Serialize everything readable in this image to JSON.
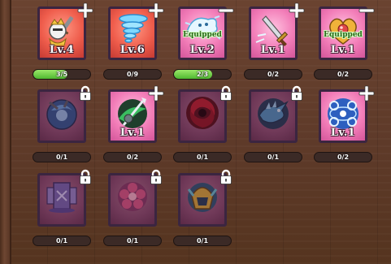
{
  "colors": {
    "progress_fill": "#4fb830",
    "card_red": "#ef5d4c",
    "card_pink": "#f27db8",
    "card_purple": "#8e4e72"
  },
  "skills": [
    {
      "icon": "knight-icon",
      "frame": "red",
      "level": "Lv.4",
      "equipped": "",
      "badge": "plus",
      "locked": false,
      "progress_text": "3/5",
      "progress": 0.6
    },
    {
      "icon": "tornado-icon",
      "frame": "red",
      "level": "Lv.6",
      "equipped": "",
      "badge": "plus",
      "locked": false,
      "progress_text": "0/9",
      "progress": 0
    },
    {
      "icon": "ice-spirit-icon",
      "frame": "pink",
      "level": "Lv.2",
      "equipped": "Equipped",
      "badge": "minus",
      "locked": false,
      "progress_text": "2/3",
      "progress": 0.667
    },
    {
      "icon": "sword-icon",
      "frame": "pink",
      "level": "Lv.1",
      "equipped": "",
      "badge": "plus",
      "locked": false,
      "progress_text": "0/2",
      "progress": 0
    },
    {
      "icon": "gold-heart-icon",
      "frame": "pink",
      "level": "Lv.1",
      "equipped": "Equipped",
      "badge": "minus",
      "locked": false,
      "progress_text": "0/2",
      "progress": 0
    },
    {
      "icon": "blue-swirl-creature-icon",
      "frame": "purple",
      "level": "",
      "equipped": "",
      "badge": "lock",
      "locked": true,
      "progress_text": "0/1",
      "progress": 0
    },
    {
      "icon": "green-spear-icon",
      "frame": "pink",
      "level": "Lv.1",
      "equipped": "",
      "badge": "plus",
      "locked": false,
      "progress_text": "0/2",
      "progress": 0
    },
    {
      "icon": "red-vortex-icon",
      "frame": "purple",
      "level": "",
      "equipped": "",
      "badge": "lock",
      "locked": true,
      "progress_text": "0/1",
      "progress": 0
    },
    {
      "icon": "ice-dragon-icon",
      "frame": "purple",
      "level": "",
      "equipped": "",
      "badge": "lock",
      "locked": true,
      "progress_text": "0/1",
      "progress": 0
    },
    {
      "icon": "orbit-rings-icon",
      "frame": "pink",
      "level": "Lv.1",
      "equipped": "",
      "badge": "plus",
      "locked": false,
      "progress_text": "0/2",
      "progress": 0
    },
    {
      "icon": "totem-shield-icon",
      "frame": "purple",
      "level": "",
      "equipped": "",
      "badge": "lock",
      "locked": true,
      "progress_text": "0/1",
      "progress": 0
    },
    {
      "icon": "flower-burst-icon",
      "frame": "purple",
      "level": "",
      "equipped": "",
      "badge": "lock",
      "locked": true,
      "progress_text": "0/1",
      "progress": 0
    },
    {
      "icon": "golden-helmet-icon",
      "frame": "purple",
      "level": "",
      "equipped": "",
      "badge": "lock",
      "locked": true,
      "progress_text": "0/1",
      "progress": 0
    }
  ]
}
